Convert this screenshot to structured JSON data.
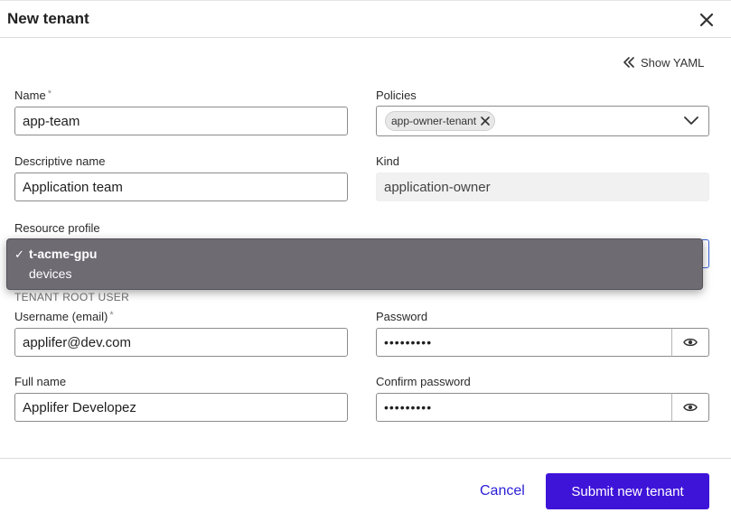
{
  "dialog": {
    "title": "New tenant",
    "show_yaml_label": "Show YAML"
  },
  "fields": {
    "name": {
      "label": "Name",
      "required_mark": "*",
      "value": "app-team"
    },
    "policies": {
      "label": "Policies",
      "chips": [
        "app-owner-tenant"
      ]
    },
    "descriptive_name": {
      "label": "Descriptive name",
      "value": "Application team"
    },
    "kind": {
      "label": "Kind",
      "value": "application-owner"
    },
    "resource_profile": {
      "label": "Resource profile",
      "options": [
        {
          "label": "t-acme-gpu",
          "selected": true
        },
        {
          "label": "devices",
          "selected": false
        }
      ],
      "check_mark": "✓"
    }
  },
  "root_user": {
    "section_title": "TENANT ROOT USER",
    "username": {
      "label": "Username (email)",
      "required_mark": "*",
      "value": "applifer@dev.com"
    },
    "password": {
      "label": "Password",
      "value": "•••••••••"
    },
    "full_name": {
      "label": "Full name",
      "value": "Applifer Developez"
    },
    "confirm_password": {
      "label": "Confirm password",
      "value": "•••••••••"
    }
  },
  "footer": {
    "cancel_label": "Cancel",
    "submit_label": "Submit new tenant"
  },
  "colors": {
    "primary": "#3f14d9",
    "link": "#2a1fd6",
    "popup_bg": "#6e6b73",
    "focus_border": "#3b63d9"
  },
  "icons": {
    "close": "close-icon",
    "show_yaml": "double-chevron-left-icon",
    "chip_remove": "close-icon",
    "dropdown": "chevron-down-icon",
    "password_toggle": "eye-icon"
  }
}
